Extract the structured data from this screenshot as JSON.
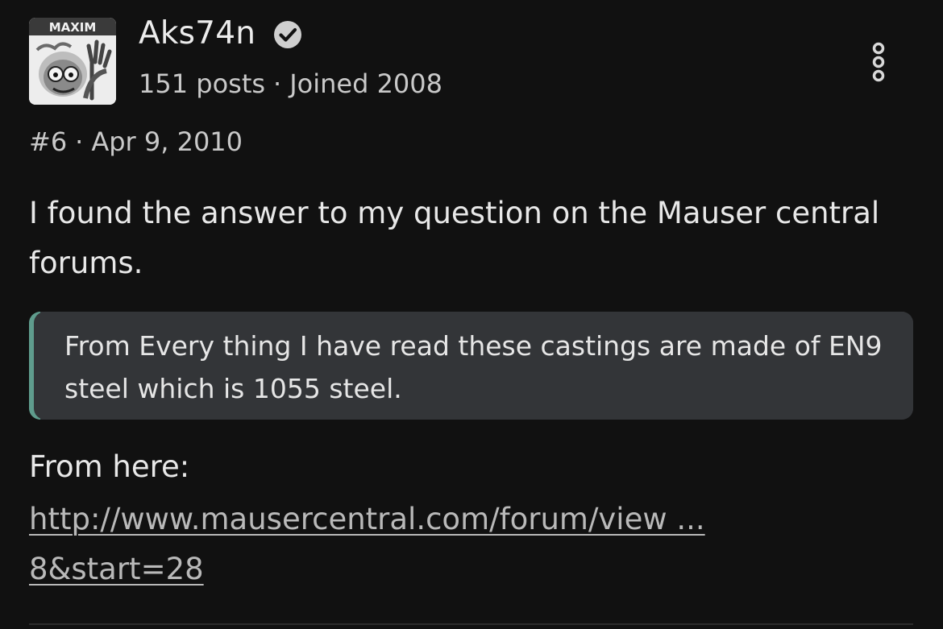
{
  "post": {
    "user": {
      "name": "Aks74n",
      "posts": "151 posts",
      "separator": "·",
      "joined": "Joined 2008",
      "avatar_text": "MAXIM"
    },
    "post_number": "#6",
    "date": "Apr 9, 2010",
    "body": "I found the answer to my question on the Mauser central forums.",
    "quote": "From Every thing I have read these castings are made of EN9 steel which is 1055 steel.",
    "from_label": "From here:",
    "link_line1": "http://www.mausercentral.com/forum/view ...",
    "link_line2": "8&start=28"
  },
  "colors": {
    "background": "#111111",
    "quote_bg": "#333538",
    "quote_accent": "#5f9c8d",
    "link": "#b9b9b9"
  },
  "icons": {
    "verified": "verified-check-icon",
    "menu": "more-options-icon"
  }
}
